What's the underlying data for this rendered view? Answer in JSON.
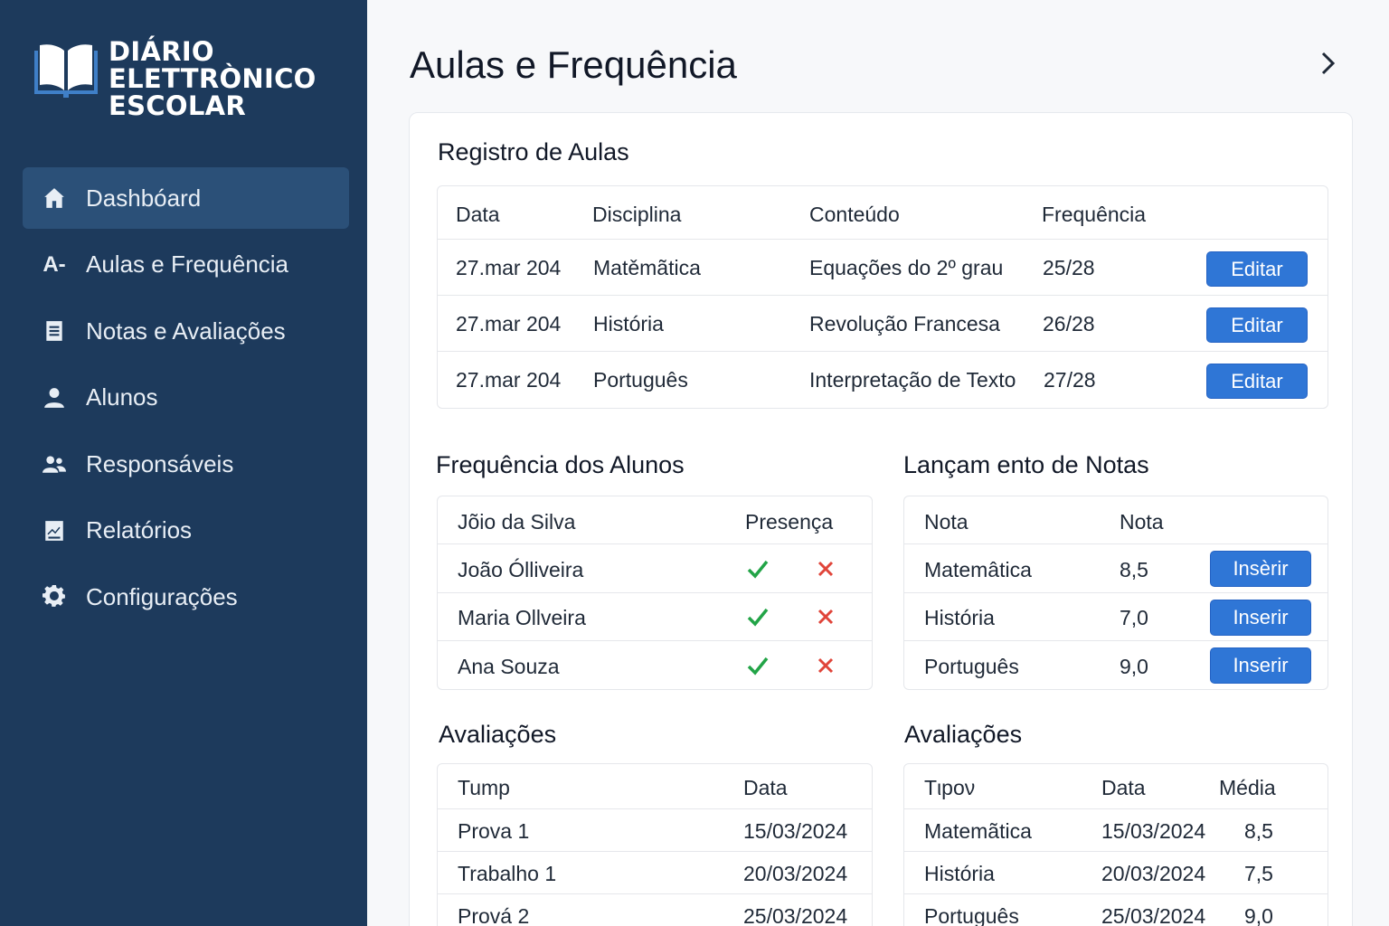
{
  "brand": {
    "line1": "DIÁRIO",
    "line2": "ELETTRÒNICO",
    "line3": "ESCOLAR",
    "icon": "open-book-icon"
  },
  "sidebar": {
    "items": [
      {
        "label": "Dashbóard",
        "icon": "home-icon",
        "active": true
      },
      {
        "label": "Aulas e Frequência",
        "icon": "a-minus-icon",
        "icon_text": "A-"
      },
      {
        "label": "Notas e Avaliações",
        "icon": "document-icon"
      },
      {
        "label": "Alunos",
        "icon": "person-icon"
      },
      {
        "label": "Responsáveis",
        "icon": "people-icon"
      },
      {
        "label": "Relatórios",
        "icon": "report-icon"
      },
      {
        "label": "Configurações",
        "icon": "gear-icon"
      }
    ]
  },
  "header": {
    "title": "Aulas e Frequência",
    "next_icon": "chevron-right-icon"
  },
  "aulas": {
    "title": "Registro de Aulas",
    "columns": [
      "Data",
      "Disciplina",
      "Conteúdo",
      "Frequência"
    ],
    "rows": [
      {
        "data": "27.mar 204",
        "disciplina": "Matěmãtica",
        "conteudo": "Equações do 2º grau",
        "frequencia": "25/28",
        "action": "Editar"
      },
      {
        "data": "27.mar 204",
        "disciplina": "História",
        "conteudo": "Revolução Francesa",
        "frequencia": "26/28",
        "action": "Editar"
      },
      {
        "data": "27.mar 204",
        "disciplina": "Português",
        "conteudo": "Interpretação de Texto",
        "frequencia": "27/28",
        "action": "Editar"
      }
    ]
  },
  "frequencia": {
    "title": "Frequência dos Alunos",
    "columns": [
      "Jõio da Silva",
      "Presença"
    ],
    "rows": [
      {
        "nome": "João Ólliveira"
      },
      {
        "nome": "Maria Ollveira"
      },
      {
        "nome": "Ana Souza"
      }
    ],
    "colors": {
      "present": "#22a447",
      "absent": "#e0453a"
    }
  },
  "notas": {
    "title": "Lançam ento de Notas",
    "columns": [
      "Nota",
      "Nota"
    ],
    "rows": [
      {
        "disciplina": "Matemâtica",
        "nota": "8,5",
        "action": "Insèrir"
      },
      {
        "disciplina": "História",
        "nota": "7,0",
        "action": "Inserir"
      },
      {
        "disciplina": "Português",
        "nota": "9,0",
        "action": "Inserir"
      }
    ]
  },
  "avaliacoes_left": {
    "title": "Avaliações",
    "columns": [
      "Tump",
      "Data"
    ],
    "rows": [
      {
        "tipo": "Prova 1",
        "data": "15/03/2024"
      },
      {
        "tipo": "Trabalho 1",
        "data": "20/03/2024"
      },
      {
        "tipo": "Prová 2",
        "data": "25/03/2024"
      }
    ]
  },
  "avaliacoes_right": {
    "title": "Avaliações",
    "columns": [
      "Tιpoν",
      "Data",
      "Média"
    ],
    "rows": [
      {
        "disciplina": "Matemãtica",
        "data": "15/03/2024",
        "media": "8,5"
      },
      {
        "disciplina": "História",
        "data": "20/03/2024",
        "media": "7,5"
      },
      {
        "disciplina": "Português",
        "data": "25/03/2024",
        "media": "9,0"
      }
    ]
  },
  "colors": {
    "sidebar": "#1d3a5c",
    "sidebar_active": "#2b5078",
    "accent": "#2f76d6"
  }
}
